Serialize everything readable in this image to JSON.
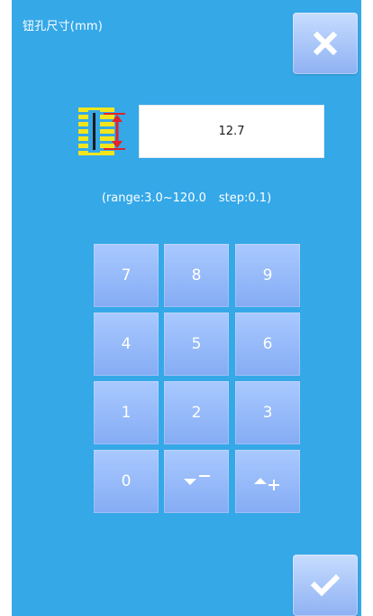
{
  "title": "钮孔尺寸(mm)",
  "value": "12.7",
  "range": {
    "range_label": "(range:3.0~120.0",
    "step_label": "step:0.1)"
  },
  "keypad": {
    "k7": "7",
    "k8": "8",
    "k9": "9",
    "k4": "4",
    "k5": "5",
    "k6": "6",
    "k1": "1",
    "k2": "2",
    "k3": "3",
    "k0": "0"
  },
  "icons": {
    "close": "close-icon",
    "confirm": "checkmark-icon",
    "decrement": "triangle-down-minus-icon",
    "increment": "triangle-up-plus-icon",
    "buttonhole": "buttonhole-size-icon"
  },
  "colors": {
    "background": "#35a8e8",
    "key": "#93b6f6",
    "field": "#ffffff",
    "icon_yellow": "#f1e51d",
    "icon_red": "#e0242a"
  }
}
